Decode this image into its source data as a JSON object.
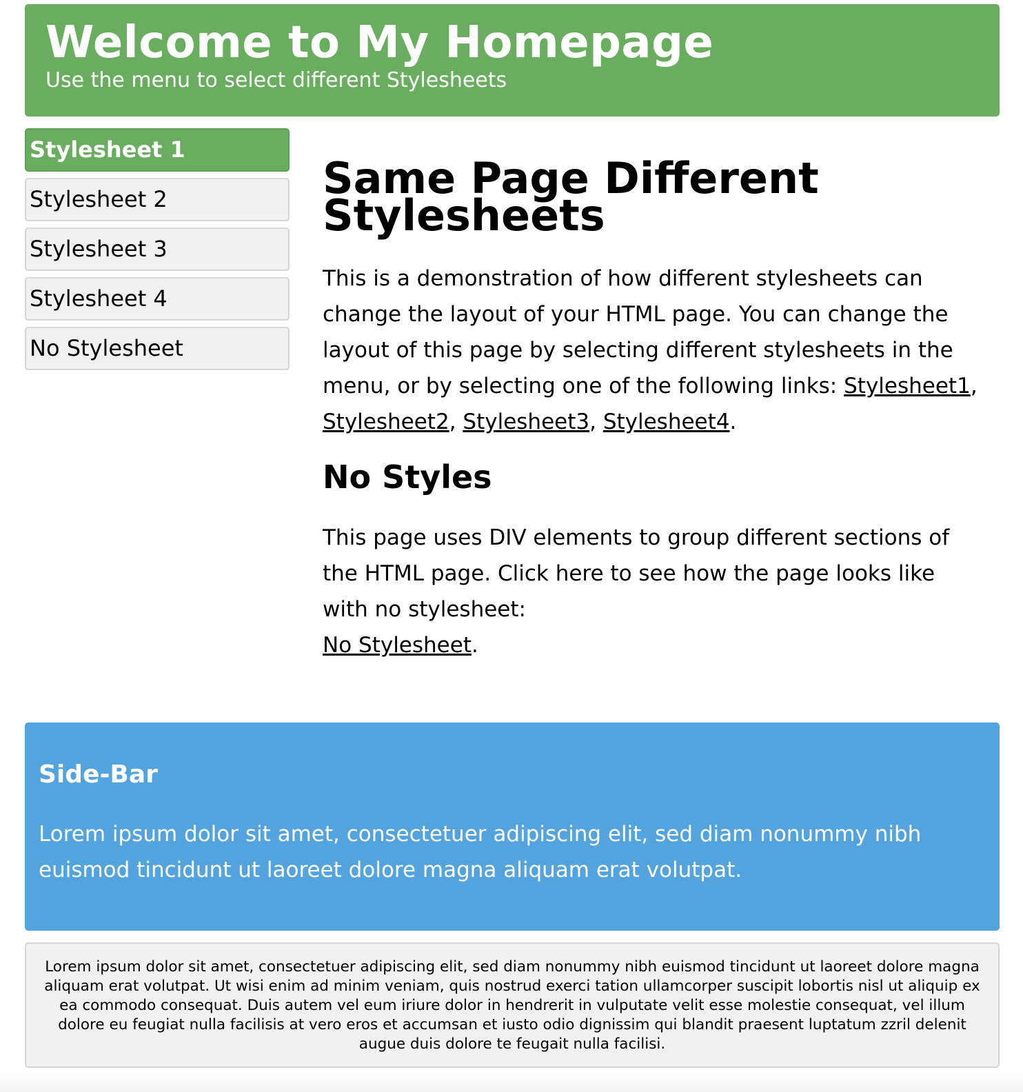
{
  "colors": {
    "header_bg": "#69ae5f",
    "menu_active_bg": "#69ae5f",
    "sidebar_bg": "#53a3df"
  },
  "header": {
    "title": "Welcome to My Homepage",
    "subtitle": "Use the menu to select different Stylesheets"
  },
  "menu": {
    "items": [
      {
        "label": "Stylesheet 1",
        "active": true
      },
      {
        "label": "Stylesheet 2",
        "active": false
      },
      {
        "label": "Stylesheet 3",
        "active": false
      },
      {
        "label": "Stylesheet 4",
        "active": false
      },
      {
        "label": "No Stylesheet",
        "active": false
      }
    ]
  },
  "main": {
    "title": "Same Page Different Stylesheets",
    "intro": "This is a demonstration of how different stylesheets can change the layout of your HTML page. You can change the layout of this page by selecting different stylesheets in the menu, or by selecting one of the following links:",
    "links": [
      "Stylesheet1",
      "Stylesheet2",
      "Stylesheet3",
      "Stylesheet4"
    ],
    "link_separator": ", ",
    "link_end": ".",
    "section_title": "No Styles",
    "section_text": "This page uses DIV elements to group different sections of the HTML page. Click here to see how the page looks like with no stylesheet:",
    "section_link": "No Stylesheet",
    "section_link_end": "."
  },
  "sidebar": {
    "title": "Side-Bar",
    "text": "Lorem ipsum dolor sit amet, consectetuer adipiscing elit, sed diam nonummy nibh euismod tincidunt ut laoreet dolore magna aliquam erat volutpat."
  },
  "footer": {
    "text": "Lorem ipsum dolor sit amet, consectetuer adipiscing elit, sed diam nonummy nibh euismod tincidunt ut laoreet dolore magna aliquam erat volutpat. Ut wisi enim ad minim veniam, quis nostrud exerci tation ullamcorper suscipit lobortis nisl ut aliquip ex ea commodo consequat. Duis autem vel eum iriure dolor in hendrerit in vulputate velit esse molestie consequat, vel illum dolore eu feugiat nulla facilisis at vero eros et accumsan et iusto odio dignissim qui blandit praesent luptatum zzril delenit augue duis dolore te feugait nulla facilisi."
  }
}
